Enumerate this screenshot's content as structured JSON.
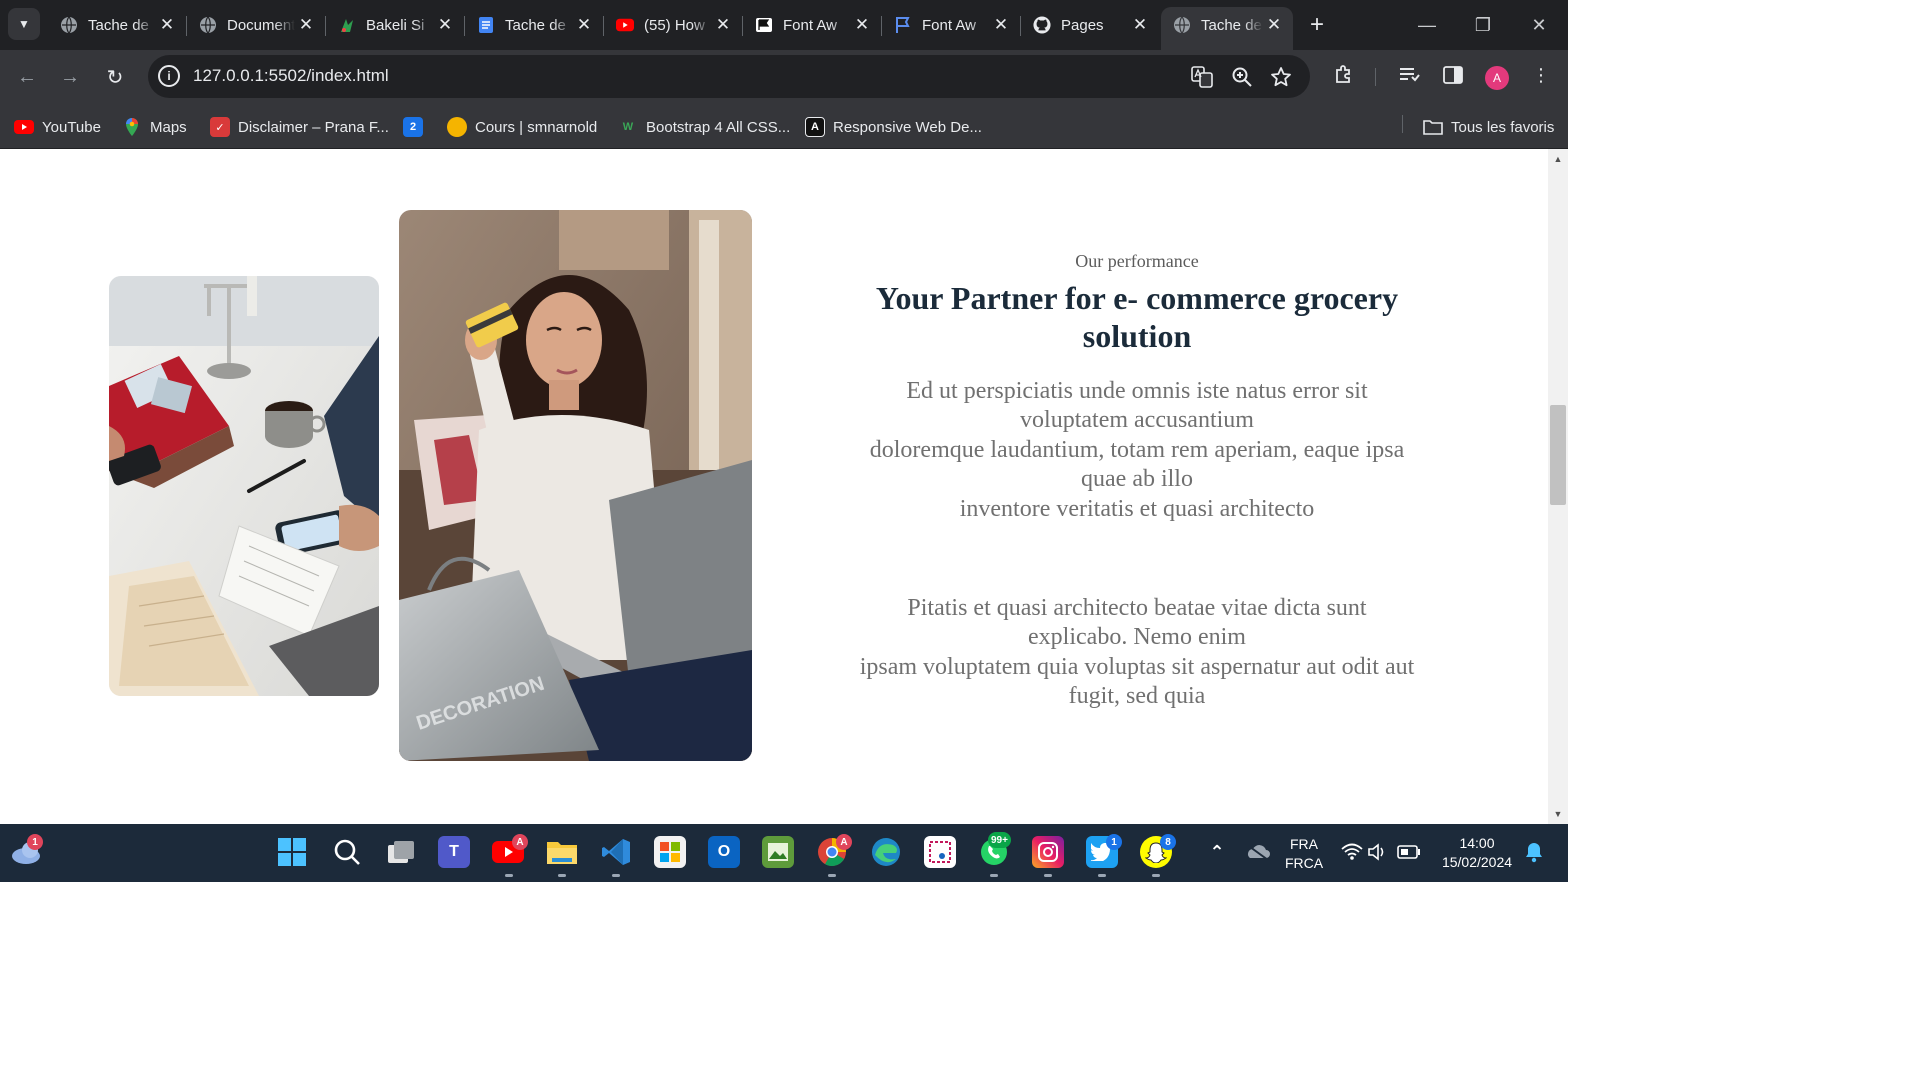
{
  "browser": {
    "tabs": [
      {
        "title": "Tache de",
        "icon": "globe-icon"
      },
      {
        "title": "Document",
        "icon": "globe-icon"
      },
      {
        "title": "Bakeli Si",
        "icon": "bakeli-icon"
      },
      {
        "title": "Tache de",
        "icon": "docs-icon"
      },
      {
        "title": "(55) How",
        "icon": "youtube-icon"
      },
      {
        "title": "Font Aw",
        "icon": "flag-icon"
      },
      {
        "title": "Font Aw",
        "icon": "flag-outline-icon"
      },
      {
        "title": "Pages",
        "icon": "github-icon"
      },
      {
        "title": "Tache de",
        "icon": "globe-icon",
        "active": true
      }
    ],
    "url": "127.0.0.1:5502/index.html",
    "profile_initial": "A",
    "bookmarks": [
      {
        "label": "YouTube",
        "icon": "youtube-icon",
        "color": "#ff0000"
      },
      {
        "label": "Maps",
        "icon": "maps-pin-icon",
        "color": "#34a853"
      },
      {
        "label": "Disclaimer – Prana F...",
        "icon": "prana-icon",
        "color": "#d93a3a"
      },
      {
        "label": "",
        "icon": "number-2-icon",
        "glyph": "2",
        "color": "#1a73e8"
      },
      {
        "label": "Cours | smnarnold",
        "icon": "smnarnold-icon",
        "color": "#f5b400"
      },
      {
        "label": "Bootstrap 4 All CSS...",
        "icon": "w-icon",
        "glyph": "W",
        "color": "#3aa757"
      },
      {
        "label": "Responsive Web De...",
        "icon": "a-icon",
        "glyph": "A",
        "color": "#111111"
      }
    ],
    "all_bookmarks_label": "Tous les favoris"
  },
  "page": {
    "eyebrow": "Our performance",
    "headline": "Your Partner for e- commerce grocery solution",
    "paragraph1": [
      "Ed ut perspiciatis unde omnis iste natus error sit voluptatem accusantium",
      "doloremque laudantium, totam rem aperiam, eaque ipsa quae ab illo",
      "inventore veritatis et quasi architecto"
    ],
    "paragraph2": [
      "Pitatis et quasi architecto beatae vitae dicta sunt explicabo. Nemo enim",
      "ipsam voluptatem quia voluptas sit aspernatur aut odit aut fugit, sed quia"
    ],
    "bag_text": "DECORATION",
    "colors": {
      "headline": "#1b2b3a",
      "body": "#707070",
      "eyebrow": "#5b5b5b"
    }
  },
  "taskbar": {
    "weather_badge": "1",
    "youtube_badge": "A",
    "chrome_badge": "A",
    "whatsapp_badge": "99+",
    "twitter_badge": "1",
    "snapchat_badge": "8",
    "language_top": "FRA",
    "language_bottom": "FRCA",
    "time": "14:00",
    "date": "15/02/2024"
  }
}
